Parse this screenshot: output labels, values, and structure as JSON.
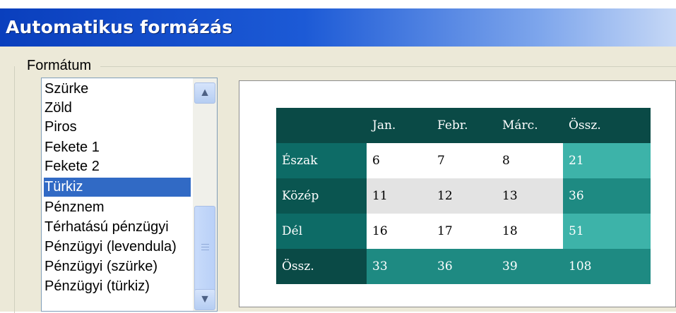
{
  "window": {
    "title": "Automatikus formázás"
  },
  "format_group": {
    "caption": "Formátum",
    "items": [
      "Szürke",
      "Zöld",
      "Piros",
      "Fekete 1",
      "Fekete 2",
      "Türkiz",
      "Pénznem",
      "Térhatású pénzügyi",
      "Pénzügyi (levendula)",
      "Pénzügyi (szürke)",
      "Pénzügyi (türkiz)"
    ],
    "selected": "Türkiz"
  },
  "preview_table": {
    "header": [
      "",
      "Jan.",
      "Febr.",
      "Márc.",
      "Össz."
    ],
    "rows": [
      [
        "Észak",
        "6",
        "7",
        "8",
        "21"
      ],
      [
        "Közép",
        "11",
        "12",
        "13",
        "36"
      ],
      [
        "Dél",
        "16",
        "17",
        "18",
        "51"
      ],
      [
        "Össz.",
        "33",
        "36",
        "39",
        "108"
      ]
    ]
  },
  "colors": {
    "title_bar": "#0a3fbd",
    "selection": "#316ac5",
    "header_teal": "#0a4a46",
    "sum_teal": "#3db3a9"
  }
}
